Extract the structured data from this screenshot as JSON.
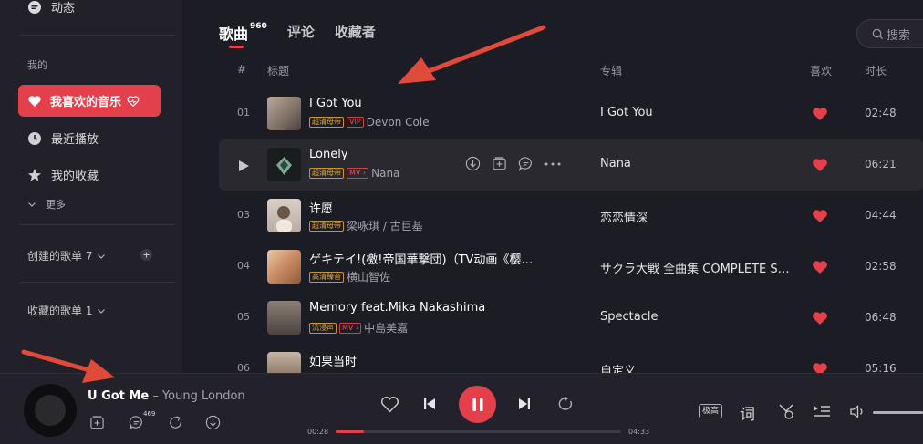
{
  "sidebar": {
    "top_item": "动态",
    "section_mine": "我的",
    "liked_music": "我喜欢的音乐",
    "recent": "最近播放",
    "favorites": "我的收藏",
    "more": "更多",
    "created_playlists": "创建的歌单 7",
    "collected_playlists": "收藏的歌单 1"
  },
  "tabs": [
    {
      "label": "歌曲",
      "count": "960"
    },
    {
      "label": "评论"
    },
    {
      "label": "收藏者"
    }
  ],
  "search": {
    "placeholder": "搜索"
  },
  "columns": {
    "num": "#",
    "title": "标题",
    "album": "专辑",
    "like": "喜欢",
    "duration": "时长"
  },
  "songs": [
    {
      "num": "01",
      "title": "I Got You",
      "tags": [
        "超清母带",
        "VIP"
      ],
      "artist": "Devon Cole",
      "album": "I Got You",
      "duration": "02:48"
    },
    {
      "num": "",
      "title": "Lonely",
      "tags": [
        "超清母带",
        "MV ›"
      ],
      "artist": "Nana",
      "album": "Nana",
      "duration": "06:21"
    },
    {
      "num": "03",
      "title": "许愿",
      "tags": [
        "超清母带"
      ],
      "artist": "梁咏琪 / 古巨基",
      "album": "恋恋情深",
      "duration": "04:44"
    },
    {
      "num": "04",
      "title": "ゲキテイ!(檄!帝国華撃団)（TV动画《樱…",
      "tags": [
        "高清臻音"
      ],
      "artist": "横山智佐",
      "album": "サクラ大戦 全曲集 COMPLETE S…",
      "duration": "02:58"
    },
    {
      "num": "05",
      "title": "Memory feat.Mika Nakashima",
      "tags": [
        "沉浸声",
        "MV ›"
      ],
      "artist": "中島美嘉",
      "album": "Spectacle",
      "duration": "06:48"
    },
    {
      "num": "06",
      "title": "如果当时",
      "tags": [],
      "artist": "",
      "album": "自定义",
      "duration": "05:16"
    }
  ],
  "player": {
    "song": "U Got Me",
    "sep": " – ",
    "artist": "Young London",
    "comment_count": "469",
    "elapsed": "00:28",
    "total": "04:33",
    "progress": 0.1,
    "quality": "极高",
    "lyrics": "词"
  },
  "colors": {
    "accent": "#e3404c",
    "bg": "#1c1c24",
    "sidebar": "#22212a",
    "annotation_arrow": "#e04a3a"
  }
}
